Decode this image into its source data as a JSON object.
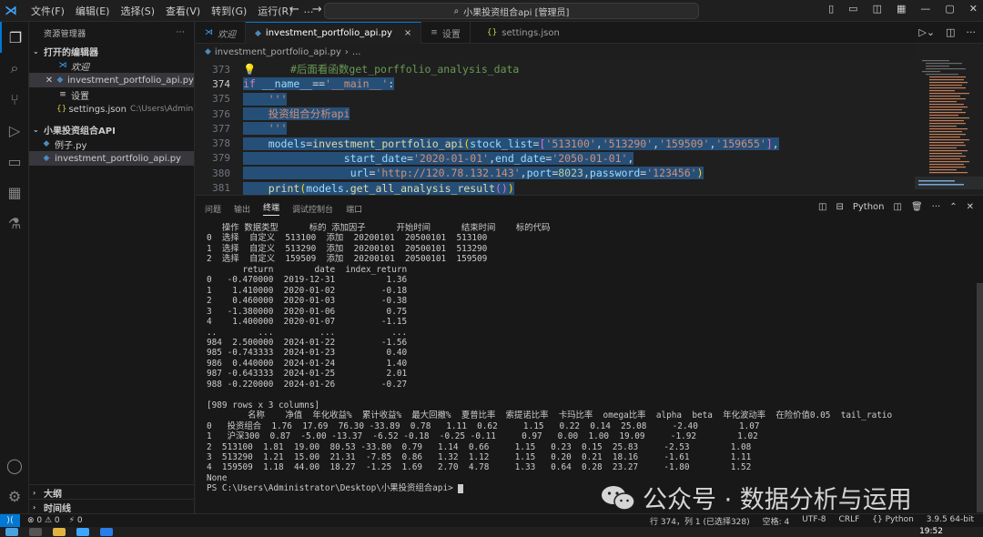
{
  "titlebar": {
    "menu": [
      "文件(F)",
      "编辑(E)",
      "选择(S)",
      "查看(V)",
      "转到(G)",
      "运行(R)",
      "…"
    ],
    "command_center": "小果投资组合api [管理员]"
  },
  "sidebar": {
    "header": "资源管理器",
    "open_editors_title": "打开的编辑器",
    "open_editors": [
      {
        "label": "欢迎",
        "icon": "vscode-icon",
        "italic": true
      },
      {
        "label": "investment_portfolio_api.py",
        "icon": "python-file-icon",
        "selected": true
      },
      {
        "label": "设置",
        "icon": "settings-file-icon"
      },
      {
        "label": "settings.json",
        "path": "C:\\Users\\Administra...",
        "icon": "json-file-icon"
      }
    ],
    "folder_title": "小果投资组合API",
    "files": [
      "例子.py",
      "investment_portfolio_api.py"
    ],
    "outline_title": "大纲",
    "timeline_title": "时间线"
  },
  "tabs": [
    {
      "label": "欢迎",
      "icon": "vscode-icon"
    },
    {
      "label": "investment_portfolio_api.py",
      "icon": "python-file-icon",
      "active": true,
      "close": "×"
    },
    {
      "label": "设置",
      "icon": "settings-file-icon"
    },
    {
      "label": "settings.json",
      "icon": "json-file-icon"
    }
  ],
  "breadcrumb": [
    "investment_portfolio_api.py",
    "..."
  ],
  "editor": {
    "line_numbers": [
      "373",
      "374",
      "375",
      "376",
      "377",
      "378",
      "379",
      "380",
      "381"
    ],
    "current_line": "374"
  },
  "panel": {
    "tabs": [
      "问题",
      "输出",
      "终端",
      "调试控制台",
      "端口"
    ],
    "active_tab": "终端",
    "terminal_label": "Python"
  },
  "terminal_lines": [
    "   操作 数据类型      标的 添加因子      开始时间      结束时间    标的代码",
    "0  选择  自定义  513100  添加  20200101  20500101  513100",
    "1  选择  自定义  513290  添加  20200101  20500101  513290",
    "2  选择  自定义  159509  添加  20200101  20500101  159509",
    "       return        date  index_return",
    "0   -0.470000  2019-12-31          1.36",
    "1    1.410000  2020-01-02         -0.18",
    "2    0.460000  2020-01-03         -0.38",
    "3   -1.380000  2020-01-06          0.75",
    "4    1.400000  2020-01-07         -1.15",
    "..        ...         ...           ...",
    "984  2.500000  2024-01-22         -1.56",
    "985 -0.743333  2024-01-23          0.40",
    "986  0.440000  2024-01-24          1.40",
    "987 -0.643333  2024-01-25          2.01",
    "988 -0.220000  2024-01-26         -0.27",
    "",
    "[989 rows x 3 columns]",
    "        名称    净值  年化收益%  累计收益%  最大回撤%  夏普比率  索提诺比率  卡玛比率  omega比率  alpha  beta  年化波动率  在险价值0.05  tail_ratio",
    "0   投资组合  1.76  17.69  76.30 -33.89  0.78   1.11  0.62     1.15   0.22  0.14  25.08     -2.40        1.07",
    "1   沪深300  0.87  -5.00 -13.37  -6.52 -0.18  -0.25 -0.11     0.97   0.00  1.00  19.09     -1.92        1.02",
    "2  513100  1.81  19.00  80.53 -33.80  0.79   1.14  0.66     1.15   0.23  0.15  25.83     -2.53        1.08",
    "3  513290  1.21  15.00  21.31  -7.85  0.86   1.32  1.12     1.15   0.20  0.21  18.16     -1.61        1.11",
    "4  159509  1.18  44.00  18.27  -1.25  1.69   2.70  4.78     1.33   0.64  0.28  23.27     -1.80        1.52",
    "None",
    "PS C:\\Users\\Administrator\\Desktop\\小果投资组合api> "
  ],
  "watermark": "公众号 · 数据分析与运用",
  "statusbar": {
    "errors": "⊗ 0 ⚠ 0",
    "ports": "⚡ 0",
    "cursor": "行 374，列 1 (已选择328)",
    "spaces": "空格: 4",
    "encoding": "UTF-8",
    "eol": "CRLF",
    "language": "Python",
    "interpreter": "3.9.5 64-bit"
  },
  "taskbar": {
    "clock": "19:52"
  }
}
